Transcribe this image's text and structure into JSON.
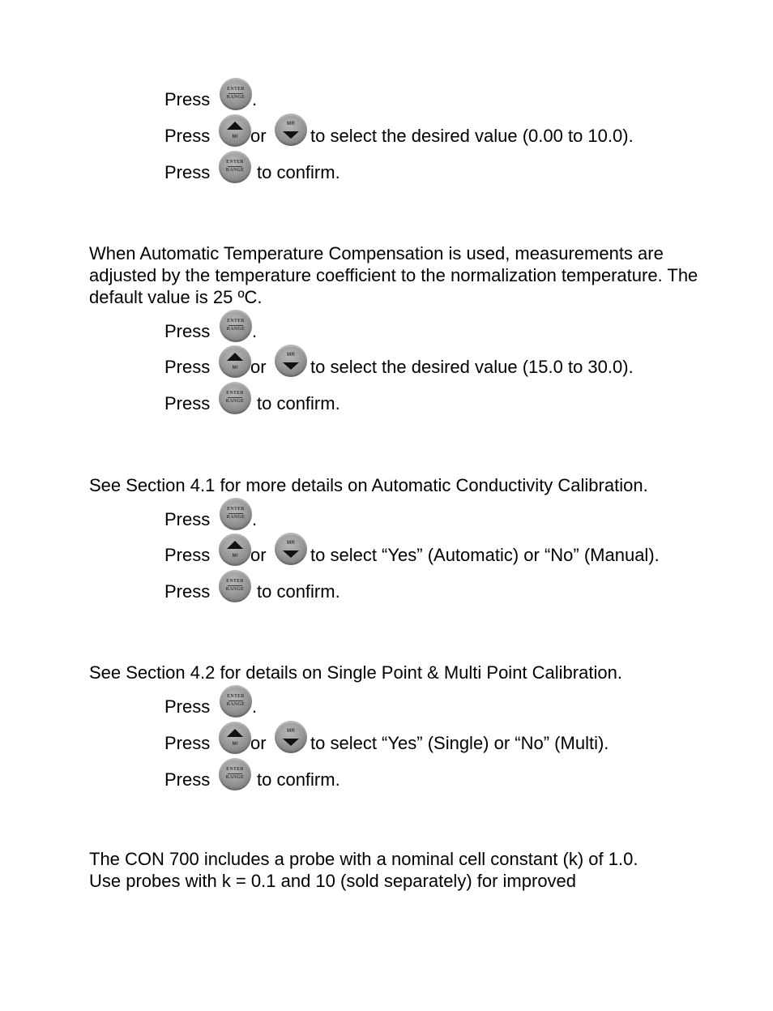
{
  "buttons": {
    "enter": {
      "top": "ENTER",
      "bottom": "RANGE"
    },
    "up": {
      "label": "MI"
    },
    "down": {
      "label": "MR"
    }
  },
  "words": {
    "press": "Press",
    "or": "or",
    "period": ".",
    "confirm": "to confirm."
  },
  "section1": {
    "select_text": "to select the desired value (0.00 to 10.0)."
  },
  "section2": {
    "paragraph": "When Automatic Temperature Compensation is used, measurements are adjusted by the temperature coefficient to the normalization temperature. The default value is 25 ºC.",
    "select_text": "to select the desired value (15.0 to 30.0)."
  },
  "section3": {
    "paragraph": "See Section 4.1 for more details on Automatic Conductivity Calibration.",
    "select_text": "to select “Yes” (Automatic) or “No” (Manual)."
  },
  "section4": {
    "paragraph": "See Section 4.2 for details on Single Point & Multi Point Calibration.",
    "select_text": "to select “Yes” (Single) or “No” (Multi)."
  },
  "section5": {
    "paragraph_line1": "The CON 700 includes a probe with a nominal cell constant (k) of 1.0.",
    "paragraph_line2": "Use probes with k = 0.1 and 10 (sold separately) for improved"
  }
}
